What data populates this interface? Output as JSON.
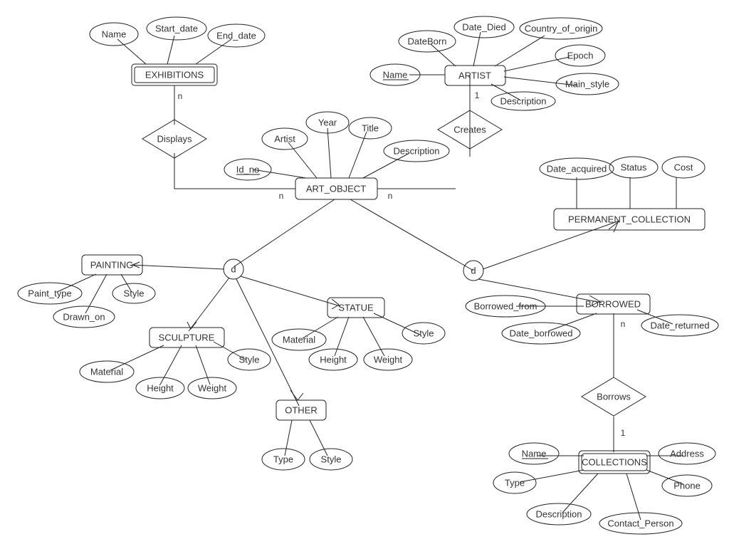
{
  "entities": {
    "exhibitions": "EXHIBITIONS",
    "art_object": "ART_OBJECT",
    "artist": "ARTIST",
    "painting": "PAINTING",
    "sculpture": "SCULPTURE",
    "statue": "STATUE",
    "other": "OTHER",
    "permanent_collection": "PERMANENT_COLLECTION",
    "borrowed": "BORROWED",
    "collections": "COLLECTIONS"
  },
  "relationships": {
    "displays": "Displays",
    "creates": "Creates",
    "borrows": "Borrows"
  },
  "disjoint": {
    "d1": "d",
    "d2": "d"
  },
  "attributes": {
    "exh_name": "Name",
    "exh_start": "Start_date",
    "exh_end": "End_date",
    "ao_idno": "Id_no",
    "ao_artist": "Artist",
    "ao_year": "Year",
    "ao_title": "Title",
    "ao_desc": "Description",
    "ar_dateborn": "DateBorn",
    "ar_datedied": "Date_Died",
    "ar_country": "Country_of_origin",
    "ar_epoch": "Epoch",
    "ar_mainstyle": "Main_style",
    "ar_desc": "Description",
    "ar_name": "Name",
    "pa_painttype": "Paint_type",
    "pa_drawnon": "Drawn_on",
    "pa_style": "Style",
    "sc_material": "Material",
    "sc_height": "Height",
    "sc_weight": "Weight",
    "sc_style": "Style",
    "st_material": "Material",
    "st_height": "Height",
    "st_weight": "Weight",
    "st_style": "Style",
    "ot_type": "Type",
    "ot_style": "Style",
    "pc_dateacq": "Date_acquired",
    "pc_status": "Status",
    "pc_cost": "Cost",
    "bo_from": "Borrowed_from",
    "bo_dateborrowed": "Date_borrowed",
    "bo_datereturned": "Date_returned",
    "co_name": "Name",
    "co_address": "Address",
    "co_type": "Type",
    "co_phone": "Phone",
    "co_desc": "Description",
    "co_contact": "Contact_Person"
  },
  "cardinalities": {
    "exh_n": "n",
    "ao_left_n": "n",
    "ao_right_n": "n",
    "artist_1": "1",
    "borrowed_n": "n",
    "collections_1": "1"
  }
}
